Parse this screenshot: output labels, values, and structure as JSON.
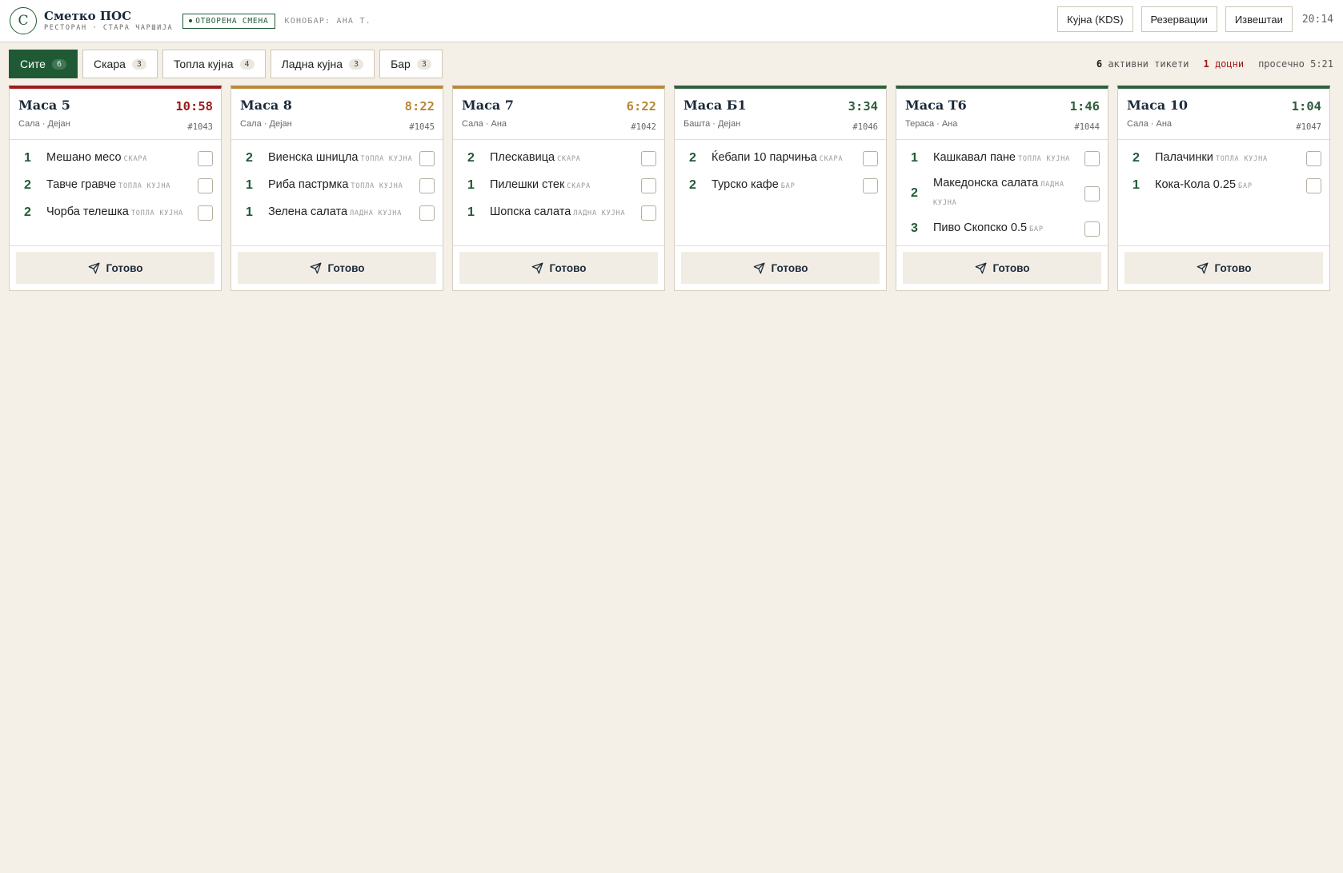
{
  "header": {
    "logo_letter": "С",
    "brand_name": "Сметко ПОС",
    "brand_sub": "РЕСТОРАН · СТАРА ЧАРШИЈА",
    "shift_badge": "ОТВОРЕНА СМЕНА",
    "waiter": "КОНОБАР: АНА Т.",
    "buttons": {
      "kitchen": "Кујна (KDS)",
      "reservations": "Резервации",
      "reports": "Извештаи"
    },
    "clock": "20:14"
  },
  "filters": {
    "tabs": [
      {
        "label": "Сите",
        "count": "6",
        "active": true
      },
      {
        "label": "Скара",
        "count": "3",
        "active": false
      },
      {
        "label": "Топла кујна",
        "count": "4",
        "active": false
      },
      {
        "label": "Ладна кујна",
        "count": "3",
        "active": false
      },
      {
        "label": "Бар",
        "count": "3",
        "active": false
      }
    ],
    "stats": {
      "active_count": "6",
      "active_label": "активни тикети",
      "late_count": "1",
      "late_label": "доцни",
      "average": "просечно 5:21"
    }
  },
  "colors": {
    "accent": "#1f5a35",
    "late": "#9c1b1b",
    "warning": "#b8873a",
    "ok": "#2f5e3c"
  },
  "tickets": [
    {
      "title": "Маса 5",
      "timer": "10:58",
      "status": "late",
      "meta": "Сала · Дејан",
      "number": "#1043",
      "items": [
        {
          "qty": "1",
          "name": "Мешано месо",
          "station": "СКАРА"
        },
        {
          "qty": "2",
          "name": "Тавче гравче",
          "station": "ТОПЛА КУЈНА"
        },
        {
          "qty": "2",
          "name": "Чорба телешка",
          "station": "ТОПЛА КУЈНА"
        }
      ],
      "done_label": "Готово"
    },
    {
      "title": "Маса 8",
      "timer": "8:22",
      "status": "warning",
      "meta": "Сала · Дејан",
      "number": "#1045",
      "items": [
        {
          "qty": "2",
          "name": "Виенска шницла",
          "station": "ТОПЛА КУЈНА"
        },
        {
          "qty": "1",
          "name": "Риба пастрмка",
          "station": "ТОПЛА КУЈНА"
        },
        {
          "qty": "1",
          "name": "Зелена салата",
          "station": "ЛАДНА КУЈНА"
        }
      ],
      "done_label": "Готово"
    },
    {
      "title": "Маса 7",
      "timer": "6:22",
      "status": "warning",
      "meta": "Сала · Ана",
      "number": "#1042",
      "items": [
        {
          "qty": "2",
          "name": "Плескавица",
          "station": "СКАРА"
        },
        {
          "qty": "1",
          "name": "Пилешки стек",
          "station": "СКАРА"
        },
        {
          "qty": "1",
          "name": "Шопска салата",
          "station": "ЛАДНА КУЈНА"
        }
      ],
      "done_label": "Готово"
    },
    {
      "title": "Маса Б1",
      "timer": "3:34",
      "status": "ok",
      "meta": "Башта · Дејан",
      "number": "#1046",
      "items": [
        {
          "qty": "2",
          "name": "Ќебапи 10 парчиња",
          "station": "СКАРА"
        },
        {
          "qty": "2",
          "name": "Турско кафе",
          "station": "БАР"
        }
      ],
      "done_label": "Готово"
    },
    {
      "title": "Маса Т6",
      "timer": "1:46",
      "status": "ok",
      "meta": "Тераса · Ана",
      "number": "#1044",
      "items": [
        {
          "qty": "1",
          "name": "Кашкавал пане",
          "station": "ТОПЛА КУЈНА"
        },
        {
          "qty": "2",
          "name": "Македонска салата",
          "station": "ЛАДНА КУЈНА"
        },
        {
          "qty": "3",
          "name": "Пиво Скопско 0.5",
          "station": "БАР"
        }
      ],
      "done_label": "Готово"
    },
    {
      "title": "Маса 10",
      "timer": "1:04",
      "status": "ok",
      "meta": "Сала · Ана",
      "number": "#1047",
      "items": [
        {
          "qty": "2",
          "name": "Палачинки",
          "station": "ТОПЛА КУЈНА"
        },
        {
          "qty": "1",
          "name": "Кока-Кола 0.25",
          "station": "БАР"
        }
      ],
      "done_label": "Готово"
    }
  ]
}
